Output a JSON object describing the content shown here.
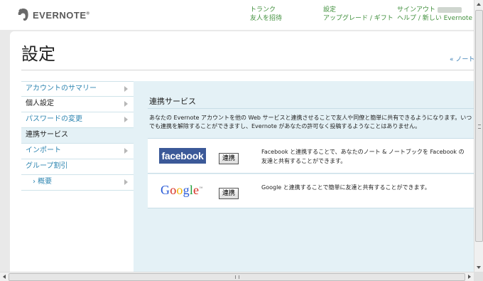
{
  "header": {
    "logo_text": "EVERNOTE",
    "nav": {
      "trunk": "トランク",
      "invite": "友人を招待",
      "settings": "設定",
      "upgrade": "アップグレード / ギフト",
      "signout": "サインアウト",
      "help": "ヘルプ / 新しい Evernote を試"
    }
  },
  "page": {
    "title": "設定",
    "back_link": "« ノートに戻る"
  },
  "sidebar": {
    "items": [
      {
        "label": "アカウントのサマリー",
        "has_arrow": true
      },
      {
        "label": "個人設定",
        "has_arrow": true
      },
      {
        "label": "パスワードの変更",
        "has_arrow": true
      },
      {
        "label": "連携サービス",
        "has_arrow": false
      },
      {
        "label": "インポート",
        "has_arrow": true
      },
      {
        "label": "グループ割引",
        "has_arrow": false
      },
      {
        "label": "› 概要",
        "has_arrow": true
      }
    ]
  },
  "content": {
    "section_title": "連携サービス",
    "description": "あなたの Evernote アカウントを他の Web サービスと連携させることで友人や同僚と簡単に共有できるようになります。いつでも連携を解除することができますし、Evernote があなたの許可なく投稿するようなことはありません。",
    "services": [
      {
        "name": "facebook",
        "button_label": "連携",
        "text": "Facebook と連携することで、あなたのノート & ノートブックを Facebook の友達と共有することができます。"
      },
      {
        "name": "Google",
        "button_label": "連携",
        "text": "Google と連携することで簡単に友達と共有することができます。"
      }
    ]
  },
  "colors": {
    "nav_green": "#3f8f3b",
    "link_blue": "#2f86b1",
    "panel_bg": "#e4f1f6",
    "facebook_blue": "#3b5998"
  }
}
